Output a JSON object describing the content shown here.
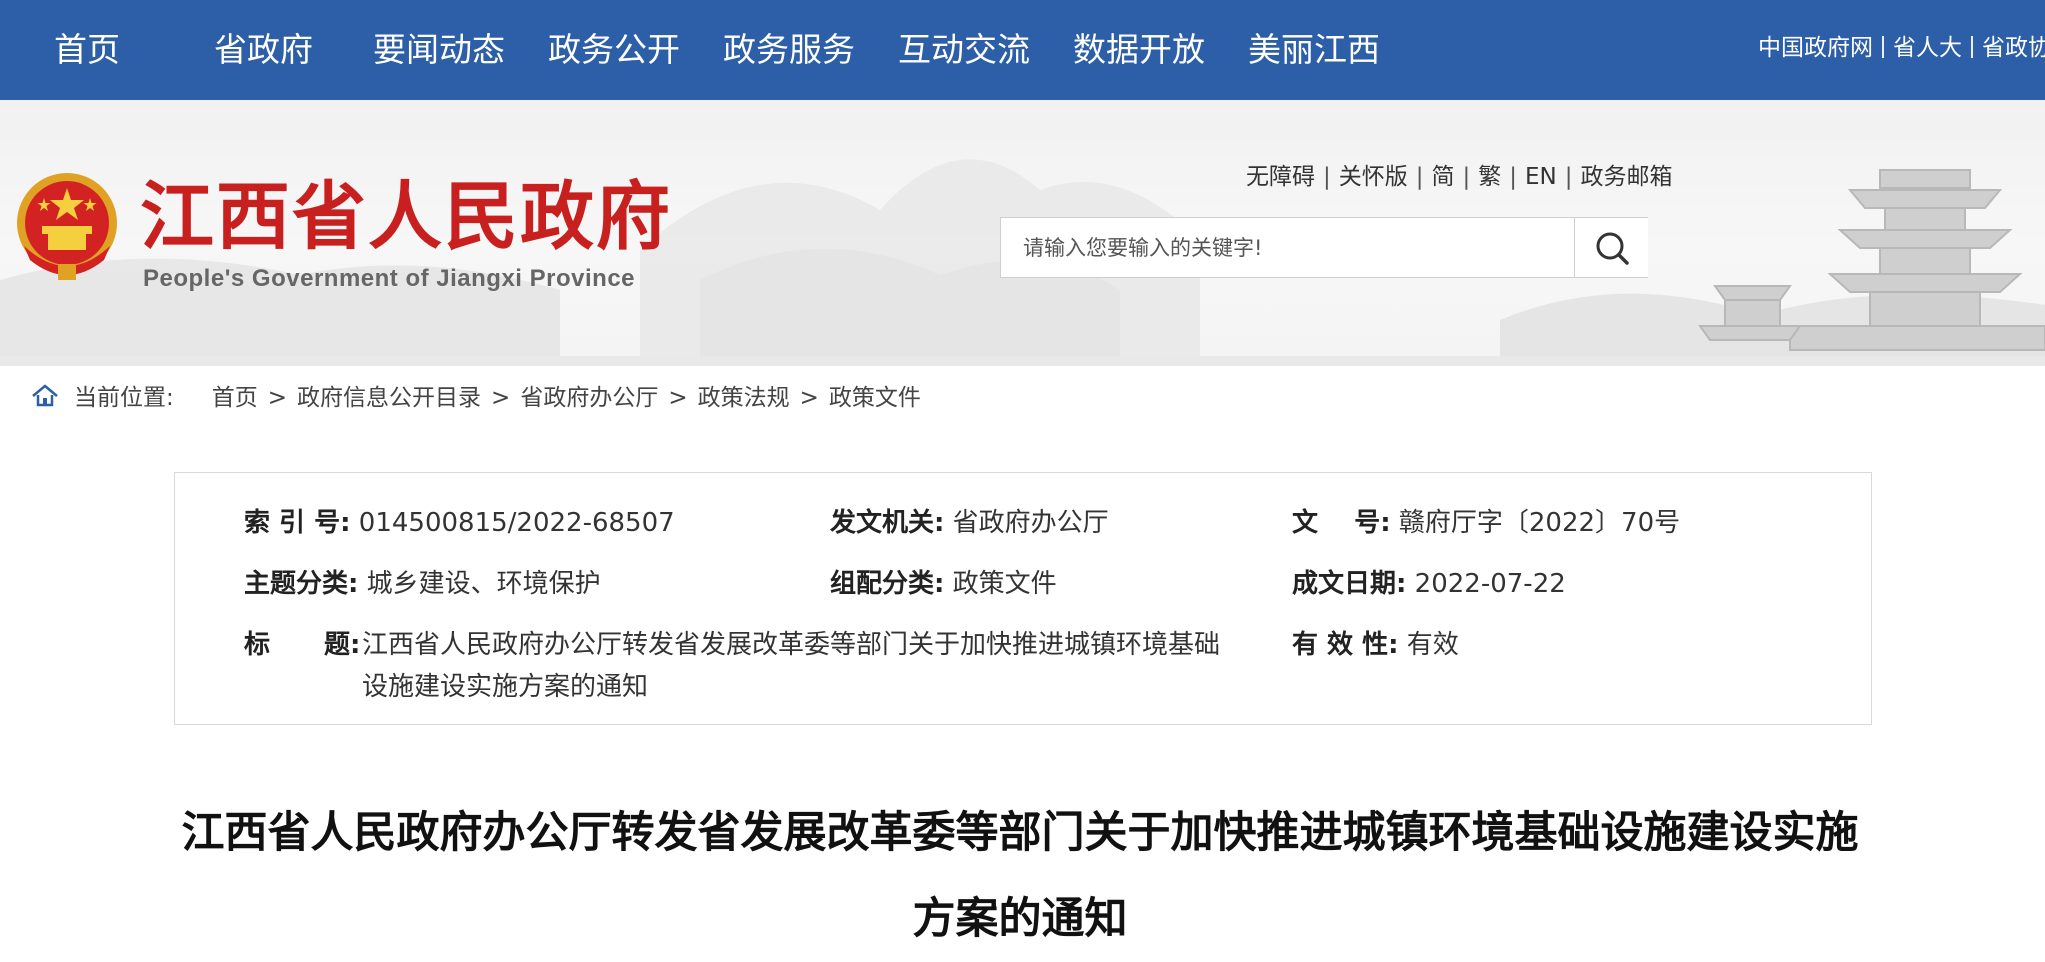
{
  "nav": {
    "items": [
      "首页",
      "省政府",
      "要闻动态",
      "政务公开",
      "政务服务",
      "互动交流",
      "数据开放",
      "美丽江西"
    ],
    "right_links": [
      "中国政府网",
      "省人大",
      "省政协"
    ]
  },
  "header": {
    "logo_title": "江西省人民政府",
    "logo_subtitle": "People's Government of Jiangxi Province",
    "utility_links": [
      "无障碍",
      "关怀版",
      "简",
      "繁",
      "EN",
      "政务邮箱"
    ],
    "search_placeholder": "请输入您要输入的关键字!",
    "search_icon": "search-icon",
    "brand_color": "#2d5ea8",
    "logo_red": "#c8201f"
  },
  "breadcrumb": {
    "icon": "home-icon",
    "label": "当前位置:",
    "items": [
      "首页",
      "政府信息公开目录",
      "省政府办公厅",
      "政策法规",
      "政策文件"
    ],
    "separator": ">"
  },
  "info": {
    "index_label": "索 引 号:",
    "index_value": "014500815/2022-68507",
    "issuer_label": "发文机关:",
    "issuer_value": "省政府办公厅",
    "docno_label": "文    号:",
    "docno_value": "赣府厅字〔2022〕70号",
    "topic_label": "主题分类:",
    "topic_value": "城乡建设、环境保护",
    "category_label": "组配分类:",
    "category_value": "政策文件",
    "date_label": "成文日期:",
    "date_value": "2022-07-22",
    "title_label_1": "标",
    "title_label_2": "题:",
    "title_value": "江西省人民政府办公厅转发省发展改革委等部门关于加快推进城镇环境基础设施建设实施方案的通知",
    "validity_label": "有 效 性:",
    "validity_value": "有效"
  },
  "article": {
    "title": "江西省人民政府办公厅转发省发展改革委等部门关于加快推进城镇环境基础设施建设实施方案的通知"
  }
}
